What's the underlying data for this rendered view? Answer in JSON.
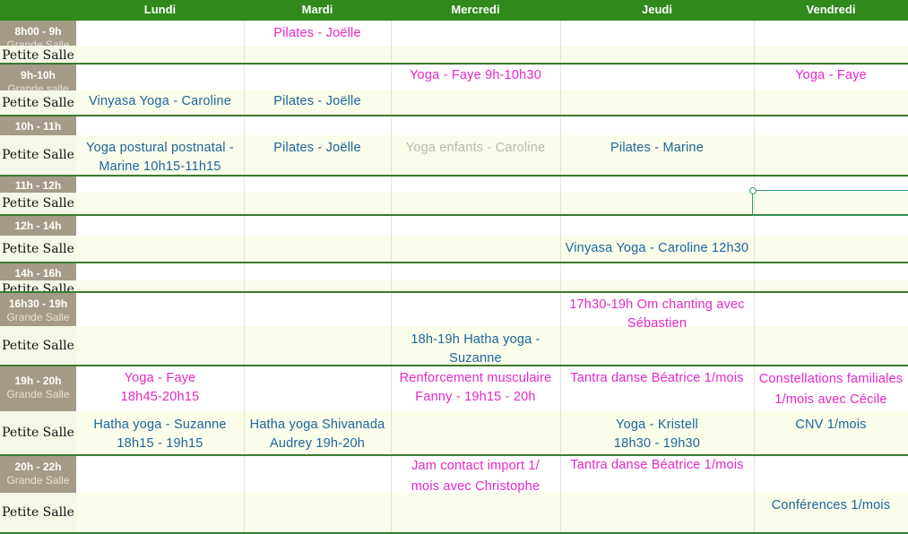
{
  "days": [
    "Lundi",
    "Mardi",
    "Mercredi",
    "Jeudi",
    "Vendredi"
  ],
  "rows": [
    {
      "time": "8h00 - 9h",
      "time_sub": "Grande Salle",
      "room": "Petite Salle"
    },
    {
      "time": "9h-10h",
      "time_sub": "Grande salle",
      "room": "Petite Salle"
    },
    {
      "time": "10h - 11h",
      "time_sub": "",
      "room": "Petite Salle"
    },
    {
      "time": "11h - 12h",
      "time_sub": "",
      "room": "Petite Salle"
    },
    {
      "time": "12h - 14h",
      "time_sub": "",
      "room": "Petite Salle"
    },
    {
      "time": "14h - 16h",
      "time_sub": "",
      "room": "Petite Salle"
    },
    {
      "time": "16h30 - 19h",
      "time_sub": "Grande Salle",
      "room": "Petite Salle"
    },
    {
      "time": "19h - 20h",
      "time_sub": "Grande Salle",
      "room": "Petite Salle"
    },
    {
      "time": "20h - 22h",
      "time_sub": "Grande Salle",
      "room": "Petite Salle"
    }
  ],
  "events": {
    "mardi_8h_grande": "Pilates - Joëlle",
    "mercredi_9h_grande": "Yoga - Faye  9h-10h30",
    "vendredi_9h_grande": "Yoga - Faye",
    "lundi_9h_petite": "Vinyasa Yoga - Caroline",
    "mardi_9h_petite": "Pilates - Joëlle",
    "lundi_10h_petite_1": "Yoga postural postnatal -",
    "lundi_10h_petite_2": "Marine 10h15-11h15",
    "mardi_10h_petite": "Pilates - Joëlle",
    "mercredi_10h_petite": "Yoga enfants - Caroline",
    "jeudi_10h_petite": "Pilates - Marine",
    "jeudi_12h_petite": "Vinyasa Yoga - Caroline 12h30",
    "jeudi_16h_grande_1": "17h30-19h Om chanting avec",
    "jeudi_16h_grande_2": "Sébastien",
    "mercredi_16h_petite_1": "18h-19h Hatha yoga -",
    "mercredi_16h_petite_2": "Suzanne",
    "lundi_19h_grande_1": "Yoga - Faye",
    "lundi_19h_grande_2": "18h45-20h15",
    "mercredi_19h_grande_1": "Renforcement musculaire",
    "mercredi_19h_grande_2": "Fanny - 19h15 - 20h",
    "jeudi_19h_grande": "Tantra danse Béatrice 1/mois",
    "vendredi_19h_grande_1": "Constellations familiales",
    "vendredi_19h_grande_2": "1/mois avec Cécile",
    "lundi_19h_petite_1": "Hatha yoga - Suzanne",
    "lundi_19h_petite_2": "18h15 - 19h15",
    "mardi_19h_petite_1": "Hatha yoga Shivanada",
    "mardi_19h_petite_2": "Audrey 19h-20h",
    "jeudi_19h_petite_1": "Yoga - Kristell",
    "jeudi_19h_petite_2": "18h30 - 19h30",
    "vendredi_19h_petite": "CNV 1/mois",
    "mercredi_20h_grande_1": "Jam contact import 1/",
    "mercredi_20h_grande_2": "mois avec Christophe",
    "jeudi_20h_grande": "Tantra danse Béatrice 1/mois",
    "vendredi_20h_petite": "Conférences 1/mois"
  },
  "colors": {
    "header": "#2f8a1b",
    "time_label": "#a59b89",
    "room_row": "#fafde9",
    "grande_salle_text": "#e528c9",
    "petite_salle_text": "#1d64a0",
    "inactive_text": "#b9b9b9",
    "separator": "#3d7a2e"
  }
}
